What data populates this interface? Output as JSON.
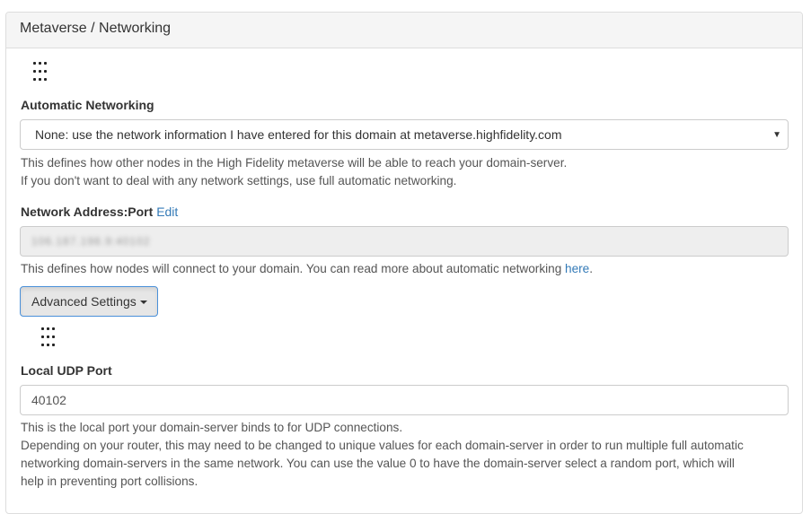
{
  "panel": {
    "title": "Metaverse / Networking"
  },
  "automatic_networking": {
    "label": "Automatic Networking",
    "selected": "None: use the network information I have entered for this domain at metaverse.highfidelity.com",
    "help_line1": "This defines how other nodes in the High Fidelity metaverse will be able to reach your domain-server.",
    "help_line2": "If you don't want to deal with any network settings, use full automatic networking."
  },
  "network_address": {
    "label": "Network Address:Port",
    "edit_link": "Edit",
    "value": "106.187.198.9:40102",
    "help_text": "This defines how nodes will connect to your domain. You can read more about automatic networking ",
    "help_link": "here",
    "help_end": "."
  },
  "advanced": {
    "button_label": "Advanced Settings"
  },
  "local_udp_port": {
    "label": "Local UDP Port",
    "value": "40102",
    "help_line1": "This is the local port your domain-server binds to for UDP connections.",
    "help_line2": "Depending on your router, this may need to be changed to unique values for each domain-server in order to run multiple full automatic",
    "help_line3": "networking domain-servers in the same network. You can use the value 0 to have the domain-server select a random port, which will",
    "help_line4": "help in preventing port collisions."
  },
  "icons": {
    "drag_handle": "drag-handle-icon",
    "select_caret": "caret-down-icon"
  },
  "colors": {
    "link": "#337ab7",
    "panel_heading_bg": "#f5f5f5",
    "disabled_bg": "#eeeeee",
    "button_focus_border": "#4a90d9"
  }
}
